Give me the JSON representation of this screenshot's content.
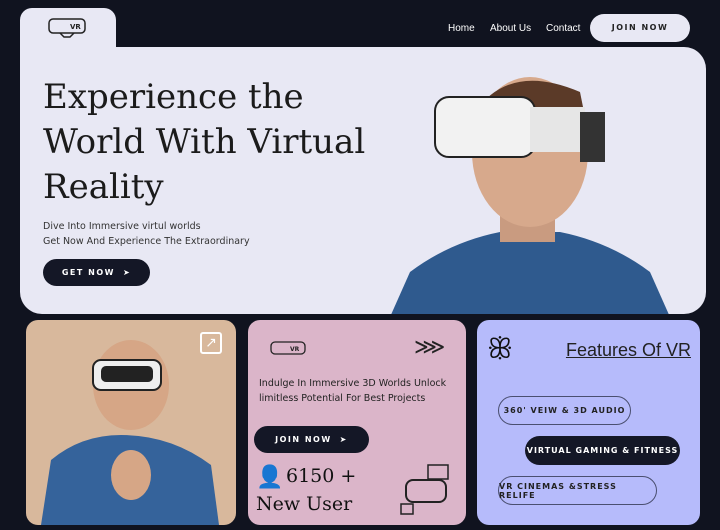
{
  "nav": {
    "logo_text": "VR",
    "items": [
      "Home",
      "About Us",
      "Contact"
    ],
    "join_label": "JOIN NOW"
  },
  "hero": {
    "title_lines": [
      "Experience the",
      "World With Virtual",
      "Reality"
    ],
    "subtitle_lines": [
      "Dive Into Immersive virtul worlds",
      "Get Now And Experience The Extraordinary"
    ],
    "cta_label": "GET NOW"
  },
  "card2": {
    "logo_text": "VR",
    "text_lines": [
      "Indulge In Immersive 3D Worlds Unlock",
      "limitless Potential For Best Projects"
    ],
    "cta_label": "JOIN NOW",
    "stat": "6150 +",
    "stat_label": "New User"
  },
  "card3": {
    "title": "Features Of VR",
    "features": [
      "360' VEIW & 3D AUDIO",
      "VIRTUAL GAMING & FITNESS",
      "VR CINEMAS &STRESS RELIFE"
    ]
  },
  "colors": {
    "background": "#10131f",
    "hero": "#e8e8f4",
    "card1": "#d8b89c",
    "card2": "#dbb5c9",
    "card3": "#b6bbfb",
    "dark": "#141726"
  }
}
